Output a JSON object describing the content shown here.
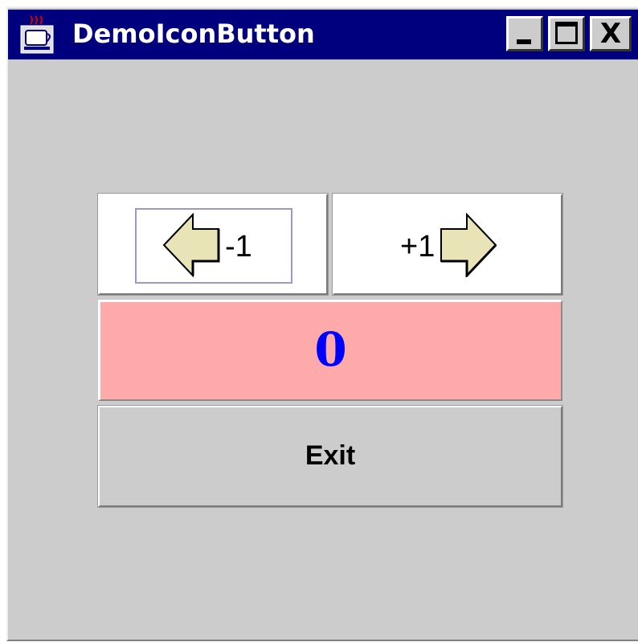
{
  "window": {
    "title": "DemoIconButton",
    "title_bar_color": "#00007f",
    "background_color": "#cccccc",
    "controls": {
      "minimize_icon": "minimize-icon",
      "maximize_icon": "maximize-icon",
      "close_glyph": "X"
    }
  },
  "buttons": {
    "decrement": {
      "label": "-1",
      "icon": "left-arrow-icon"
    },
    "increment": {
      "label": "+1",
      "icon": "right-arrow-icon"
    },
    "exit": {
      "label": "Exit"
    }
  },
  "counter": {
    "value": "0",
    "background_color": "#ffaaaa",
    "text_color": "#0000ff"
  },
  "colors": {
    "arrow_fill": "#e8e4b8",
    "focus_border": "#9999cc"
  }
}
